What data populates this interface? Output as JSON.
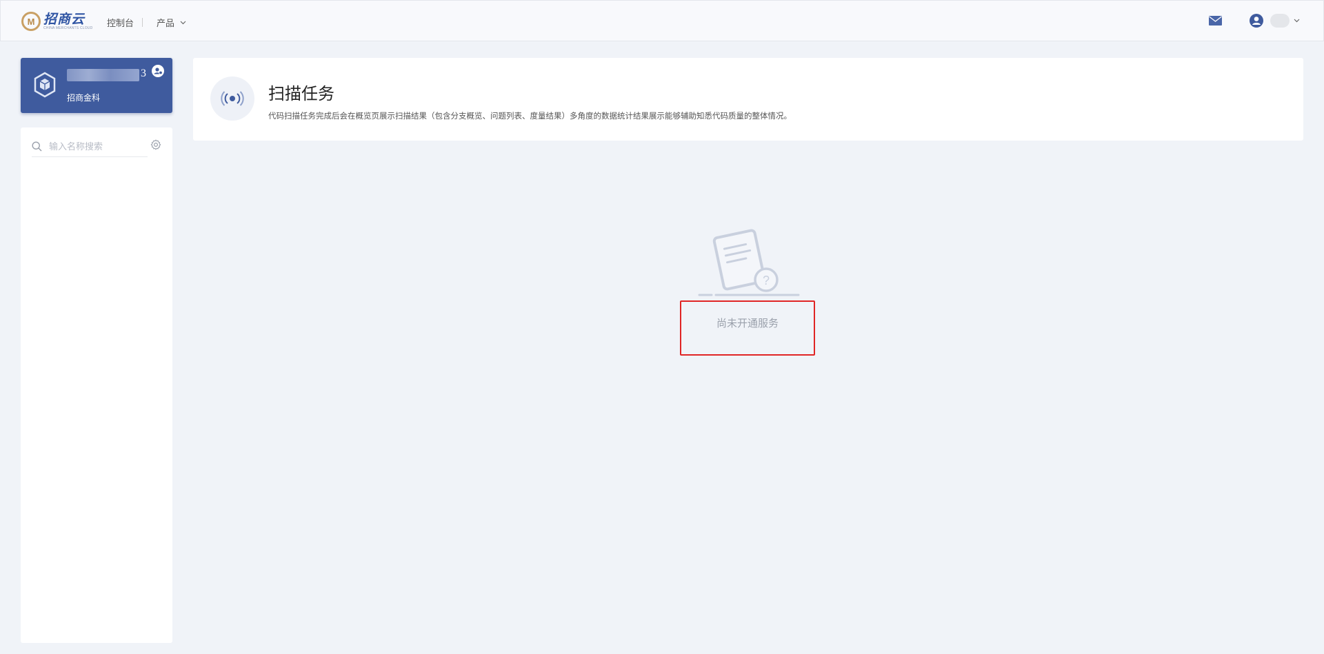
{
  "header": {
    "logo_cn": "招商云",
    "logo_en": "CHINA MERCHANTS CLOUD",
    "nav_console": "控制台",
    "nav_products": "产品"
  },
  "org_card": {
    "id_suffix": "3",
    "name": "招商金科"
  },
  "sidebar": {
    "search_placeholder": "输入名称搜索"
  },
  "main": {
    "title": "扫描任务",
    "description": "代码扫描任务完成后会在概览页展示扫描结果（包含分支概览、问题列表、度量结果）多角度的数据统计结果展示能够辅助知悉代码质量的整体情况。",
    "empty_text": "尚未开通服务"
  },
  "colors": {
    "brand_blue": "#3f5b9e",
    "highlight_red": "#e02424",
    "background": "#f0f3f8"
  }
}
